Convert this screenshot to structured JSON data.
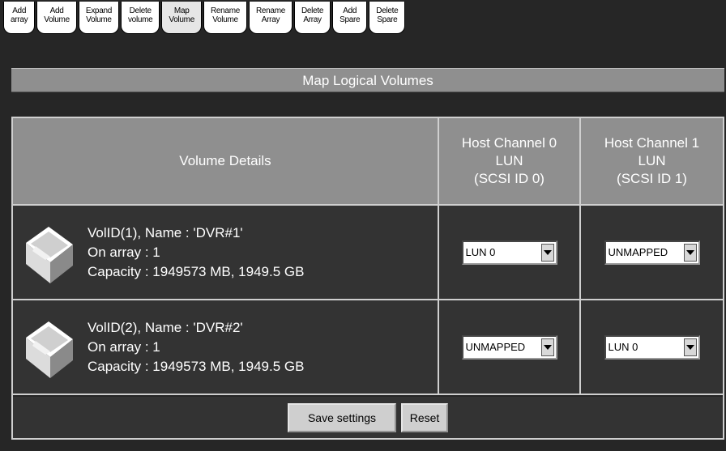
{
  "tabs": [
    {
      "line1": "Add",
      "line2": "array"
    },
    {
      "line1": "Add",
      "line2": "Volume"
    },
    {
      "line1": "Expand",
      "line2": "Volume"
    },
    {
      "line1": "Delete",
      "line2": "volume"
    },
    {
      "line1": "Map",
      "line2": "Volume"
    },
    {
      "line1": "Rename",
      "line2": "Volume"
    },
    {
      "line1": "Rename",
      "line2": "Array"
    },
    {
      "line1": "Delete",
      "line2": "Array"
    },
    {
      "line1": "Add",
      "line2": "Spare"
    },
    {
      "line1": "Delete",
      "line2": "Spare"
    }
  ],
  "page_title": "Map Logical Volumes",
  "table": {
    "col_details": "Volume Details",
    "col_host0": {
      "line1": "Host Channel 0",
      "line2": "LUN",
      "line3": "(SCSI ID 0)"
    },
    "col_host1": {
      "line1": "Host Channel 1",
      "line2": "LUN",
      "line3": "(SCSI ID 1)"
    },
    "rows": [
      {
        "name_line": "VolID(1), Name : 'DVR#1'",
        "array_line": "On array : 1",
        "capacity_line": "Capacity : 1949573 MB, 1949.5 GB",
        "host0_value": "LUN 0",
        "host1_value": "UNMAPPED"
      },
      {
        "name_line": "VolID(2), Name : 'DVR#2'",
        "array_line": "On array : 1",
        "capacity_line": "Capacity : 1949573 MB, 1949.5 GB",
        "host0_value": "UNMAPPED",
        "host1_value": "LUN 0"
      }
    ]
  },
  "buttons": {
    "save": "Save settings",
    "reset": "Reset"
  },
  "icons": {
    "volume": "disk-volume-icon",
    "dropdown": "chevron-down-icon"
  }
}
